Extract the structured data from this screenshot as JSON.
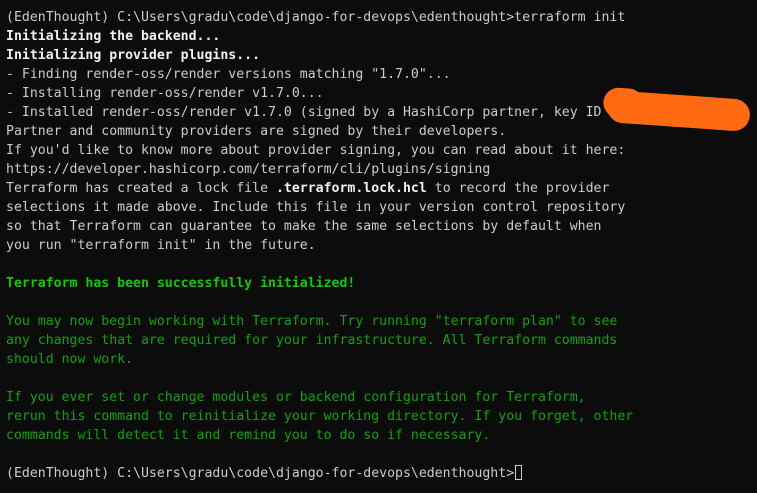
{
  "terminal": {
    "prompt_cmd": "(EdenThought) C:\\Users\\gradu\\code\\django-for-devops\\edenthought>terraform init",
    "init_backend": "Initializing the backend...",
    "init_plugins": "Initializing provider plugins...",
    "find": "- Finding render-oss/render versions matching \"1.7.0\"...",
    "installing": "- Installing render-oss/render v1.7.0...",
    "installed": "- Installed render-oss/render v1.7.0 (signed by a HashiCorp partner, key ID",
    "partner": "Partner and community providers are signed by their developers.",
    "more1": "If you'd like to know more about provider signing, you can read about it here:",
    "more2": "https://developer.hashicorp.com/terraform/cli/plugins/signing",
    "lock1_a": "Terraform has created a lock file ",
    "lock1_b": ".terraform.lock.hcl",
    "lock1_c": " to record the provider",
    "lock2": "selections it made above. Include this file in your version control repository",
    "lock3": "so that Terraform can guarantee to make the same selections by default when",
    "lock4": "you run \"terraform init\" in the future.",
    "success": "Terraform has been successfully initialized!",
    "begin1": "You may now begin working with Terraform. Try running \"terraform plan\" to see",
    "begin2": "any changes that are required for your infrastructure. All Terraform commands",
    "begin3": "should now work.",
    "modules1": "If you ever set or change modules or backend configuration for Terraform,",
    "modules2": "rerun this command to reinitialize your working directory. If you forget, other",
    "modules3": "commands will detect it and remind you to do so if necessary.",
    "prompt_final": "(EdenThought) C:\\Users\\gradu\\code\\django-for-devops\\edenthought>"
  },
  "colors": {
    "background": "#0c0c0c",
    "text": "#cccccc",
    "green": "#13a10e",
    "bright_green": "#16c60c",
    "redaction": "#ff6a13"
  }
}
